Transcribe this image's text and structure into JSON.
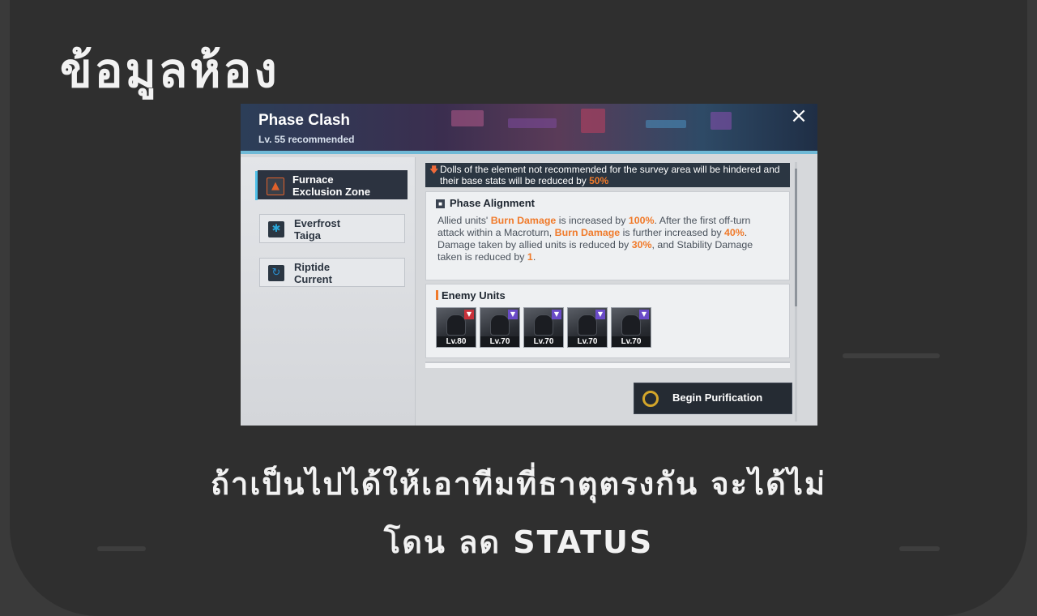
{
  "heading": "ข้อมูลห้อง",
  "caption": {
    "line1": "ถ้าเป็นไปได้ให้เอาทีมที่ธาตุตรงกัน จะได้ไม่",
    "line2": "โดน ลด STATUS"
  },
  "game": {
    "title": "Phase Clash",
    "subtitle": "Lv. 55 recommended",
    "close_icon": "×",
    "zones": [
      {
        "label_line1": "Furnace",
        "label_line2": "Exclusion Zone",
        "icon": "fire-icon",
        "color": "#e0612b",
        "active": true
      },
      {
        "label_line1": "Everfrost",
        "label_line2": "Taiga",
        "icon": "snowflake-icon",
        "color": "#2aa6d8",
        "active": false
      },
      {
        "label_line1": "Riptide",
        "label_line2": "Current",
        "icon": "wave-icon",
        "color": "#2a8fd0",
        "active": false
      }
    ],
    "warning": {
      "text_before": "Dolls of the element not recommended for the survey area will be hindered and their base stats will be reduced by ",
      "value": "50%"
    },
    "phase_alignment": {
      "title": "Phase Alignment",
      "p1a": "Allied units' ",
      "burn1": "Burn Damage",
      "p1b": " is increased by ",
      "v1": "100%",
      "p1c": ". After the first off-turn attack within a Macroturn, ",
      "burn2": "Burn Damage",
      "p1d": " is further increased by ",
      "v2": "40%",
      "p1e": ".",
      "p2a": "Damage taken by allied units is reduced by ",
      "v3": "30%",
      "p2b": ", and Stability Damage taken is reduced by ",
      "v4": "1",
      "p2c": "."
    },
    "enemy_units": {
      "title": "Enemy Units",
      "levels": [
        "Lv.80",
        "Lv.70",
        "Lv.70",
        "Lv.70",
        "Lv.70"
      ]
    },
    "begin_button": "Begin Purification",
    "colors": {
      "accent": "#f07a2a",
      "header_line": "#6fb9d6",
      "dark": "#2b3642"
    }
  }
}
